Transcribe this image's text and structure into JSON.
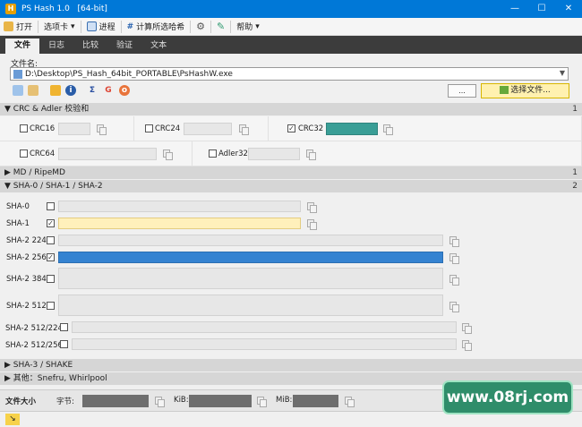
{
  "window": {
    "title": "PS Hash 1.0",
    "arch": "[64-bit]",
    "app_icon_letter": "H"
  },
  "menubar": {
    "open": "打开",
    "tabs": "选项卡",
    "progress": "进程",
    "calc_all": "计算所选哈希",
    "help": "帮助"
  },
  "tabs": [
    "文件",
    "日志",
    "比较",
    "验证",
    "文本"
  ],
  "file": {
    "label": "文件名:",
    "path": "D:\\Desktop\\PS_Hash_64bit_PORTABLE\\PsHashW.exe",
    "options_btn": "...",
    "choose_btn": "选择文件..."
  },
  "sections": {
    "crc": {
      "title": "CRC & Adler 校验和",
      "count": "1"
    },
    "md": {
      "title": "MD / RipeMD",
      "count": "1"
    },
    "sha": {
      "title": "SHA-0 / SHA-1 / SHA-2",
      "count": "2"
    },
    "sha3": {
      "title": "SHA-3 / SHAKE"
    },
    "other": {
      "title": "其他：Snefru, Whirlpool"
    }
  },
  "crc": {
    "crc16": {
      "label": "CRC16",
      "checked": false
    },
    "crc24": {
      "label": "CRC24",
      "checked": false
    },
    "crc32": {
      "label": "CRC32",
      "checked": true
    },
    "crc64": {
      "label": "CRC64",
      "checked": false
    },
    "adler32": {
      "label": "Adler32",
      "checked": false
    }
  },
  "sha": [
    {
      "label": "SHA-0",
      "checked": false
    },
    {
      "label": "SHA-1",
      "checked": true
    },
    {
      "label": "SHA-2 224",
      "checked": false
    },
    {
      "label": "SHA-2 256",
      "checked": true
    },
    {
      "label": "SHA-2 384",
      "checked": false
    },
    {
      "label": "SHA-2 512",
      "checked": false
    },
    {
      "label": "SHA-2 512/224",
      "checked": false
    },
    {
      "label": "SHA-2 512/256",
      "checked": false
    }
  ],
  "filesize": {
    "label": "文件大小",
    "bytes_label": "字节:",
    "kib_label": "KiB:",
    "mib_label": "MiB:"
  },
  "watermark": "www.08rj.com",
  "colors": {
    "titlebar": "#0078d7",
    "crc32_fill": "#3a9e96",
    "sha256_fill": "#3583d1",
    "sha1_fill": "#fff0bb"
  }
}
